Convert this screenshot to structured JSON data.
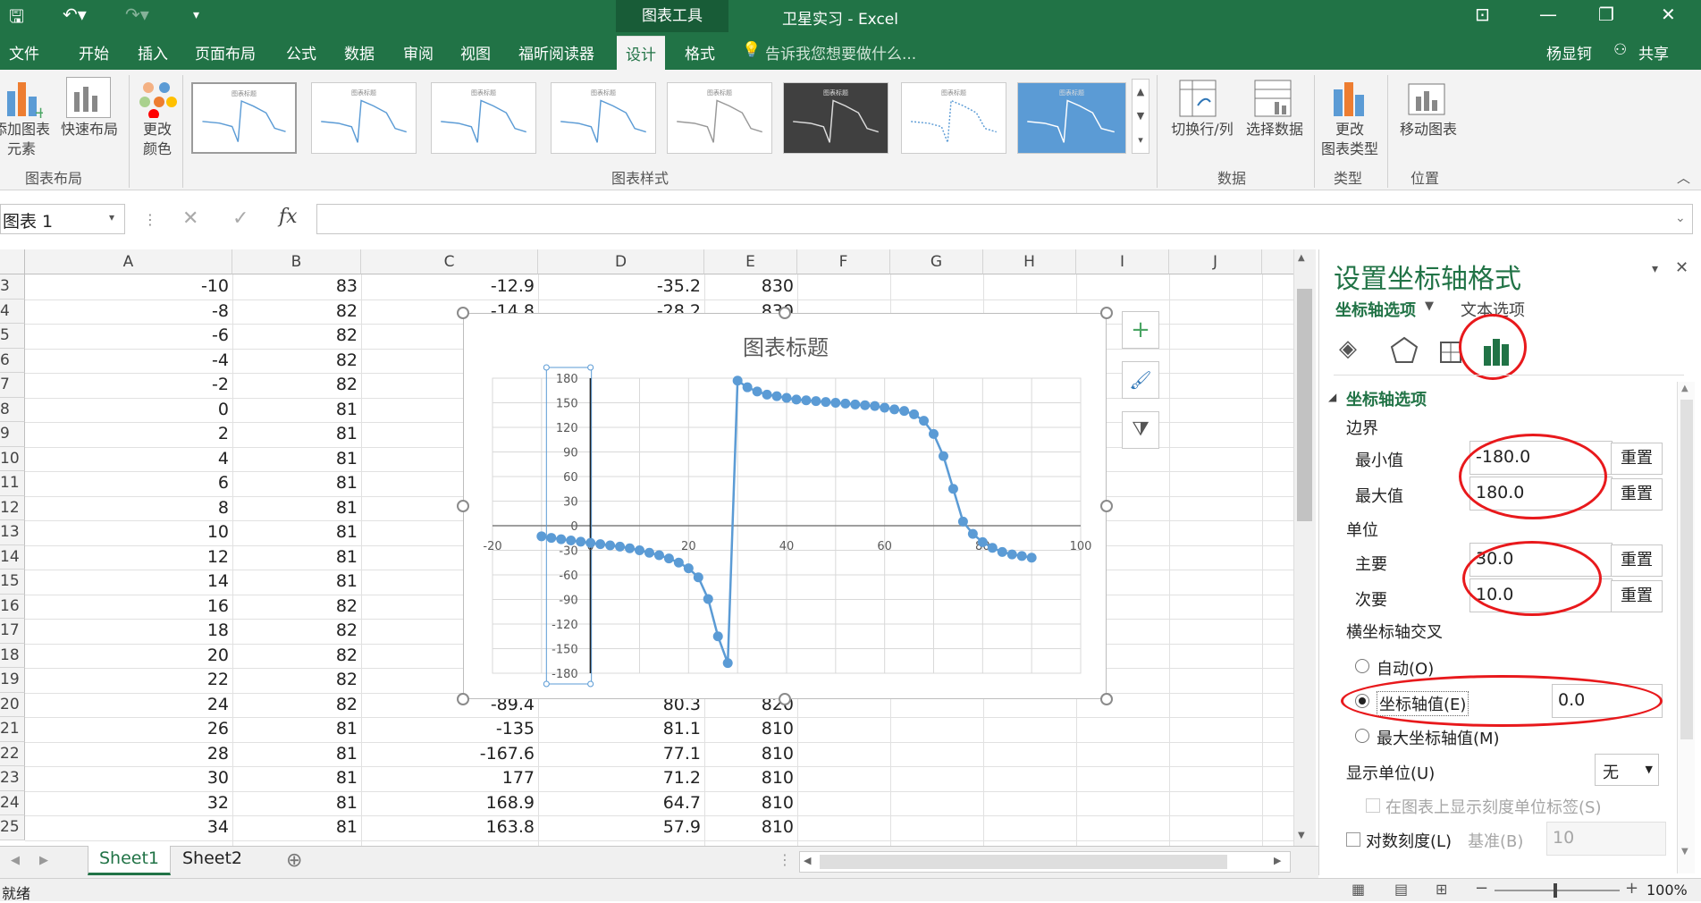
{
  "app": {
    "context_tab": "图表工具",
    "window_title": "卫星实习 - Excel",
    "user": "杨显钶",
    "share": "共享"
  },
  "tabs": [
    "文件",
    "开始",
    "插入",
    "页面布局",
    "公式",
    "数据",
    "审阅",
    "视图",
    "福昕阅读器",
    "设计",
    "格式"
  ],
  "tell_me": "告诉我您想要做什么...",
  "ribbon": {
    "add_element": "添加图表\n元素",
    "quick_layout": "快速布局",
    "group_layout": "图表布局",
    "change_colors": "更改\n颜色",
    "group_styles": "图表样式",
    "style_thumb_title": "图表标题",
    "switch_rowcol": "切换行/列",
    "select_data": "选择数据",
    "group_data": "数据",
    "change_type": "更改\n图表类型",
    "group_type": "类型",
    "move_chart": "移动图表",
    "group_location": "位置"
  },
  "namebox": "图表 1",
  "fx": "fx",
  "columns": [
    "A",
    "B",
    "C",
    "D",
    "E",
    "F",
    "G",
    "H",
    "I",
    "J"
  ],
  "rows": [
    {
      "n": "3",
      "a": "-10",
      "b": "83",
      "c": "-12.9",
      "d": "-35.2",
      "e": "830"
    },
    {
      "n": "4",
      "a": "-8",
      "b": "82",
      "c": "-14.8",
      "d": "-28.2",
      "e": "830"
    },
    {
      "n": "5",
      "a": "-6",
      "b": "82",
      "c": "",
      "d": "",
      "e": ""
    },
    {
      "n": "6",
      "a": "-4",
      "b": "82",
      "c": "",
      "d": "",
      "e": ""
    },
    {
      "n": "7",
      "a": "-2",
      "b": "82",
      "c": "",
      "d": "",
      "e": ""
    },
    {
      "n": "8",
      "a": "0",
      "b": "81",
      "c": "",
      "d": "",
      "e": ""
    },
    {
      "n": "9",
      "a": "2",
      "b": "81",
      "c": "",
      "d": "",
      "e": ""
    },
    {
      "n": "10",
      "a": "4",
      "b": "81",
      "c": "",
      "d": "",
      "e": ""
    },
    {
      "n": "11",
      "a": "6",
      "b": "81",
      "c": "",
      "d": "",
      "e": ""
    },
    {
      "n": "12",
      "a": "8",
      "b": "81",
      "c": "",
      "d": "",
      "e": ""
    },
    {
      "n": "13",
      "a": "10",
      "b": "81",
      "c": "",
      "d": "",
      "e": ""
    },
    {
      "n": "14",
      "a": "12",
      "b": "81",
      "c": "",
      "d": "",
      "e": ""
    },
    {
      "n": "15",
      "a": "14",
      "b": "81",
      "c": "",
      "d": "",
      "e": ""
    },
    {
      "n": "16",
      "a": "16",
      "b": "82",
      "c": "",
      "d": "",
      "e": ""
    },
    {
      "n": "17",
      "a": "18",
      "b": "82",
      "c": "",
      "d": "",
      "e": ""
    },
    {
      "n": "18",
      "a": "20",
      "b": "82",
      "c": "",
      "d": "",
      "e": ""
    },
    {
      "n": "19",
      "a": "22",
      "b": "82",
      "c": "",
      "d": "",
      "e": ""
    },
    {
      "n": "20",
      "a": "24",
      "b": "82",
      "c": "-89.4",
      "d": "80.3",
      "e": "820"
    },
    {
      "n": "21",
      "a": "26",
      "b": "81",
      "c": "-135",
      "d": "81.1",
      "e": "810"
    },
    {
      "n": "22",
      "a": "28",
      "b": "81",
      "c": "-167.6",
      "d": "77.1",
      "e": "810"
    },
    {
      "n": "23",
      "a": "30",
      "b": "81",
      "c": "177",
      "d": "71.2",
      "e": "810"
    },
    {
      "n": "24",
      "a": "32",
      "b": "81",
      "c": "168.9",
      "d": "64.7",
      "e": "810"
    },
    {
      "n": "25",
      "a": "34",
      "b": "81",
      "c": "163.8",
      "d": "57.9",
      "e": "810"
    }
  ],
  "sheets": [
    "Sheet1",
    "Sheet2"
  ],
  "status": {
    "ready": "就绪",
    "zoom": "100%"
  },
  "pane": {
    "title": "设置坐标轴格式",
    "tab_axis": "坐标轴选项",
    "tab_text": "文本选项",
    "section": "坐标轴选项",
    "bounds": "边界",
    "min_label": "最小值",
    "min_value": "-180.0",
    "max_label": "最大值",
    "max_value": "180.0",
    "units": "单位",
    "major_label": "主要",
    "major_value": "30.0",
    "minor_label": "次要",
    "minor_value": "10.0",
    "reset": "重置",
    "crosses": "横坐标轴交叉",
    "auto": "自动(O)",
    "axis_value": "坐标轴值(E)",
    "axis_value_input": "0.0",
    "max_axis": "最大坐标轴值(M)",
    "display_units": "显示单位(U)",
    "display_units_value": "无",
    "show_units_label": "在图表上显示刻度单位标签(S)",
    "log_scale": "对数刻度(L)",
    "base_label": "基准(B)",
    "base_value": "10"
  },
  "chart_data": {
    "type": "scatter",
    "title": "图表标题",
    "x_ticks": [
      -20,
      0,
      20,
      40,
      60,
      80,
      100
    ],
    "y_ticks": [
      -180,
      -150,
      -120,
      -90,
      -60,
      -30,
      0,
      30,
      60,
      90,
      120,
      150,
      180
    ],
    "xlim": [
      -20,
      100
    ],
    "ylim": [
      -180,
      180
    ],
    "series": [
      {
        "color": "#5b9bd5",
        "x": [
          -10,
          -8,
          -6,
          -4,
          -2,
          0,
          2,
          4,
          6,
          8,
          10,
          12,
          14,
          16,
          18,
          20,
          22,
          24,
          26,
          28,
          30,
          32,
          34,
          36,
          38,
          40,
          42,
          44,
          46,
          48,
          50,
          52,
          54,
          56,
          58,
          60,
          62,
          64,
          66,
          68,
          70,
          72,
          74,
          76,
          78,
          80,
          82,
          84,
          86,
          88,
          90
        ],
        "y": [
          -12.9,
          -14.8,
          -16.5,
          -18,
          -19.5,
          -21,
          -22.5,
          -24,
          -25.5,
          -27.5,
          -30,
          -33,
          -36,
          -40,
          -45,
          -52,
          -63,
          -89.4,
          -135,
          -167.6,
          177,
          168.9,
          163.8,
          160,
          158,
          156,
          154,
          153,
          152,
          151,
          150,
          149,
          148,
          147,
          146,
          144,
          142,
          140,
          136,
          128,
          112,
          85,
          45,
          5,
          -10,
          -20,
          -27,
          -32,
          -35,
          -37,
          -39
        ]
      }
    ]
  }
}
